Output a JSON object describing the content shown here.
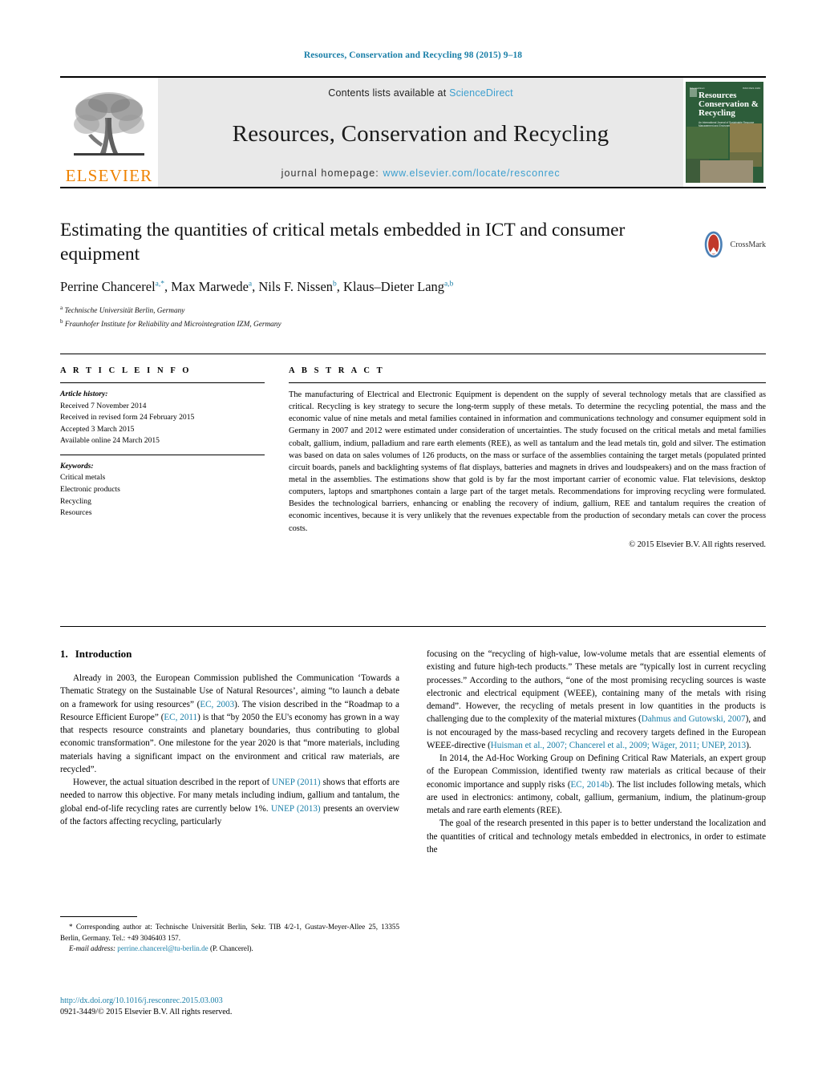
{
  "running_head": "Resources, Conservation and Recycling 98 (2015) 9–18",
  "masthead": {
    "publisher_name": "ELSEVIER",
    "contents_prefix": "Contents lists available at",
    "contents_link": "ScienceDirect",
    "journal_title": "Resources, Conservation and Recycling",
    "homepage_prefix": "journal homepage:",
    "homepage_url": "www.elsevier.com/locate/resconrec",
    "cover": {
      "title_line1": "Resources",
      "title_line2": "Conservation &",
      "title_line3": "Recycling",
      "subtitle": "An International Journal of Sustainable Resource Management and Environmental Efficiency",
      "top_left_tiny": "ScienceDirect",
      "top_right_tiny": "ISSN 0921-3449"
    }
  },
  "article": {
    "title": "Estimating the quantities of critical metals embedded in ICT and consumer equipment",
    "crossmark_label": "CrossMark",
    "authors_html": "Perrine Chancerel<sup>a,*</sup>, Max Marwede<sup>a</sup>, Nils F. Nissen<sup>b</sup>, Klaus–Dieter Lang<sup>a,b</sup>",
    "affiliations": [
      {
        "marker": "a",
        "text": "Technische Universität Berlin, Germany"
      },
      {
        "marker": "b",
        "text": "Fraunhofer Institute for Reliability and Microintegration IZM, Germany"
      }
    ]
  },
  "article_info": {
    "heading": "A R T I C L E   I N F O",
    "history_label": "Article history:",
    "history": [
      "Received 7 November 2014",
      "Received in revised form 24 February 2015",
      "Accepted 3 March 2015",
      "Available online 24 March 2015"
    ],
    "keywords_label": "Keywords:",
    "keywords": [
      "Critical metals",
      "Electronic products",
      "Recycling",
      "Resources"
    ]
  },
  "abstract": {
    "heading": "A B S T R A C T",
    "text": "The manufacturing of Electrical and Electronic Equipment is dependent on the supply of several technology metals that are classified as critical. Recycling is key strategy to secure the long-term supply of these metals. To determine the recycling potential, the mass and the economic value of nine metals and metal families contained in information and communications technology and consumer equipment sold in Germany in 2007 and 2012 were estimated under consideration of uncertainties. The study focused on the critical metals and metal families cobalt, gallium, indium, palladium and rare earth elements (REE), as well as tantalum and the lead metals tin, gold and silver. The estimation was based on data on sales volumes of 126 products, on the mass or surface of the assemblies containing the target metals (populated printed circuit boards, panels and backlighting systems of flat displays, batteries and magnets in drives and loudspeakers) and on the mass fraction of metal in the assemblies. The estimations show that gold is by far the most important carrier of economic value. Flat televisions, desktop computers, laptops and smartphones contain a large part of the target metals. Recommendations for improving recycling were formulated. Besides the technological barriers, enhancing or enabling the recovery of indium, gallium, REE and tantalum requires the creation of economic incentives, because it is very unlikely that the revenues expectable from the production of secondary metals can cover the process costs.",
    "copyright": "© 2015 Elsevier B.V. All rights reserved."
  },
  "body": {
    "section_number": "1.",
    "section_title": "Introduction",
    "left_paragraphs_html": [
      "Already in 2003, the European Commission published the Communication ‘Towards a Thematic Strategy on the Sustainable Use of Natural Resources’, aiming “to launch a debate on a framework for using resources” (<span class=\"ref\">EC, 2003</span>). The vision described in the “Roadmap to a Resource Efficient Europe” (<span class=\"ref\">EC, 2011</span>) is that “by 2050 the EU's economy has grown in a way that respects resource constraints and planetary boundaries, thus contributing to global economic transformation”. One milestone for the year 2020 is that “more materials, including materials having a significant impact on the environment and critical raw materials, are recycled”.",
      "However, the actual situation described in the report of <span class=\"ref\">UNEP (2011)</span> shows that efforts are needed to narrow this objective. For many metals including indium, gallium and tantalum, the global end-of-life recycling rates are currently below 1%. <span class=\"ref\">UNEP (2013)</span> presents an overview of the factors affecting recycling, particularly"
    ],
    "right_paragraphs_html": [
      "focusing on the “recycling of high-value, low-volume metals that are essential elements of existing and future high-tech products.” These metals are “typically lost in current recycling processes.” According to the authors, “one of the most promising recycling sources is waste electronic and electrical equipment (WEEE), containing many of the metals with rising demand”. However, the recycling of metals present in low quantities in the products is challenging due to the complexity of the material mixtures (<span class=\"ref\">Dahmus and Gutowski, 2007</span>), and is not encouraged by the mass-based recycling and recovery targets defined in the European WEEE-directive (<span class=\"ref\">Huisman et al., 2007; Chancerel et al., 2009; Wäger, 2011; UNEP, 2013</span>).",
      "In 2014, the Ad-Hoc Working Group on Defining Critical Raw Materials, an expert group of the European Commission, identified twenty raw materials as critical because of their economic importance and supply risks (<span class=\"ref\">EC, 2014b</span>). The list includes following metals, which are used in electronics: antimony, cobalt, gallium, germanium, indium, the platinum-group metals and rare earth elements (REE).",
      "The goal of the research presented in this paper is to better understand the localization and the quantities of critical and technology metals embedded in electronics, in order to estimate the"
    ]
  },
  "footnotes": {
    "corresponding_html": "* Corresponding author at: Technische Universität Berlin, Sekr. TIB 4/2-1, Gustav-Meyer-Allee 25, 13355 Berlin, Germany. Tel.: +49 3046403 157.",
    "email_label": "E-mail address:",
    "email": "perrine.chancerel@tu-berlin.de",
    "email_suffix": "(P. Chancerel)."
  },
  "doi_block": {
    "doi_url": "http://dx.doi.org/10.1016/j.resconrec.2015.03.003",
    "issn_line": "0921-3449/© 2015 Elsevier B.V. All rights reserved."
  },
  "colors": {
    "link_blue": "#1a7fa8",
    "sd_blue": "#3c9fcf",
    "elsevier_orange": "#ef8200",
    "cover_green": "#2d5d3a",
    "band_gray": "#e9e9e9"
  }
}
